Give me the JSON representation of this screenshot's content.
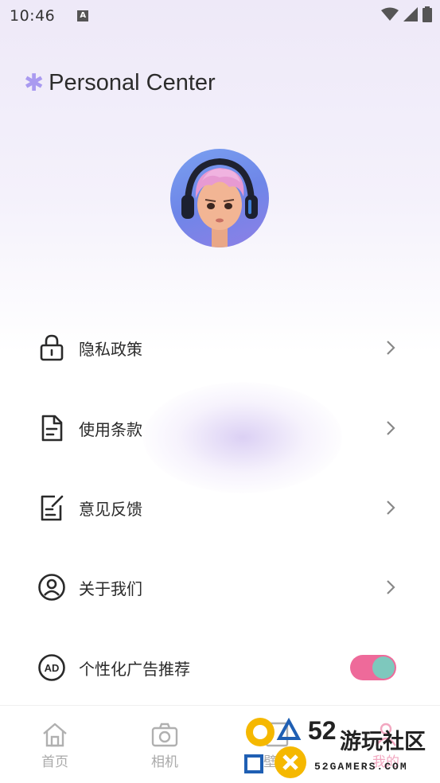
{
  "status_bar": {
    "time": "10:46",
    "indicator_letter": "A"
  },
  "header": {
    "title": "Personal Center",
    "icon": "sparkle-icon"
  },
  "profile": {
    "avatar": "avatar-girl-headphones"
  },
  "menu": [
    {
      "label": "隐私政策",
      "icon": "lock-icon"
    },
    {
      "label": "使用条款",
      "icon": "document-icon"
    },
    {
      "label": "意见反馈",
      "icon": "feedback-edit-icon"
    },
    {
      "label": "关于我们",
      "icon": "user-circle-icon"
    }
  ],
  "ad_toggle": {
    "label": "个性化广告推荐",
    "icon": "ad-icon",
    "enabled": true
  },
  "bottom_nav": [
    {
      "label": "首页",
      "icon": "home-icon"
    },
    {
      "label": "相机",
      "icon": "camera-icon"
    },
    {
      "label": "壁纸",
      "icon": "wallpaper-icon"
    },
    {
      "label": "我的",
      "icon": "profile-icon"
    }
  ],
  "watermark": {
    "number": "52",
    "name": "游玩社区",
    "domain": "52GAMERS.COM"
  },
  "colors": {
    "accent_pink": "#ee6a9a",
    "toggle_knob": "#7ec8bd",
    "title_star": "#a99af0",
    "active_nav": "#f2a7c0"
  }
}
